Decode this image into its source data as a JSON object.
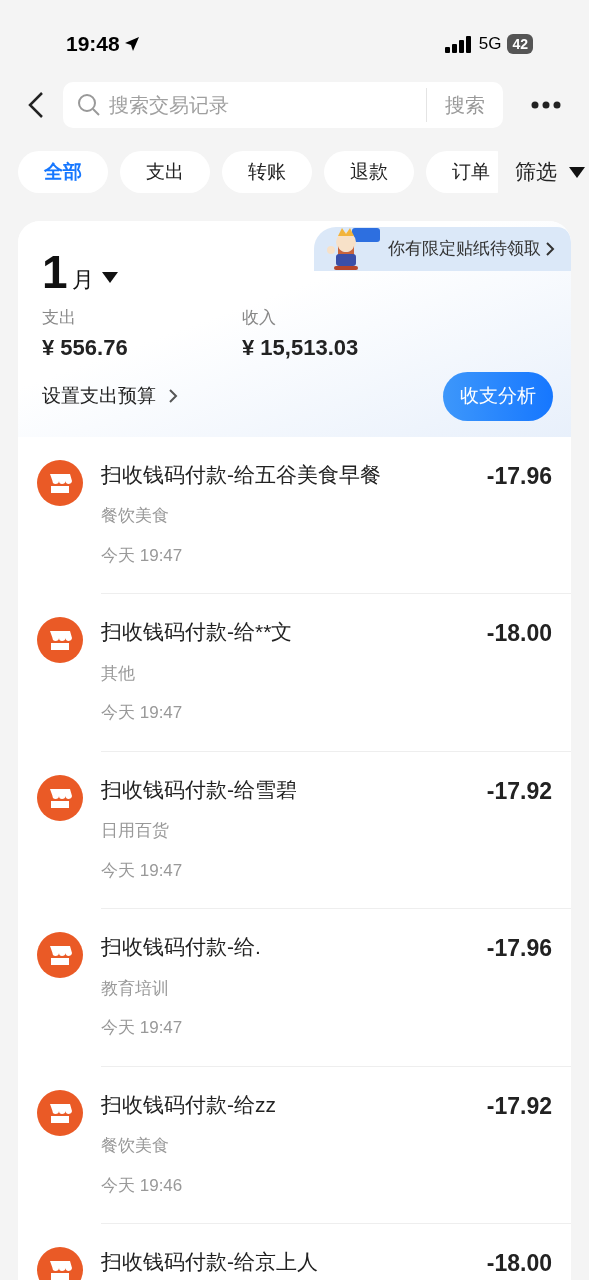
{
  "status_bar": {
    "time": "19:48",
    "network": "5G",
    "battery": "42"
  },
  "search": {
    "placeholder": "搜索交易记录",
    "button": "搜索"
  },
  "chips": [
    {
      "label": "全部",
      "selected": true
    },
    {
      "label": "支出",
      "selected": false
    },
    {
      "label": "转账",
      "selected": false
    },
    {
      "label": "退款",
      "selected": false
    },
    {
      "label": "订单",
      "selected": false
    }
  ],
  "filter": "筛选",
  "summary": {
    "banner": "你有限定贴纸待领取",
    "month": "1",
    "month_unit": "月",
    "expense_label": "支出",
    "expense": "¥ 556.76",
    "income_label": "收入",
    "income": "¥ 15,513.03",
    "budget_link": "设置支出预算",
    "analysis_button": "收支分析"
  },
  "transactions": [
    {
      "title": "扫收钱码付款-给五谷美食早餐",
      "category": "餐饮美食",
      "time": "今天 19:47",
      "amount": "-17.96"
    },
    {
      "title": "扫收钱码付款-给**文",
      "category": "其他",
      "time": "今天 19:47",
      "amount": "-18.00"
    },
    {
      "title": "扫收钱码付款-给雪碧",
      "category": "日用百货",
      "time": "今天 19:47",
      "amount": "-17.92"
    },
    {
      "title": "扫收钱码付款-给.",
      "category": "教育培训",
      "time": "今天 19:47",
      "amount": "-17.96"
    },
    {
      "title": "扫收钱码付款-给zz",
      "category": "餐饮美食",
      "time": "今天 19:46",
      "amount": "-17.92"
    },
    {
      "title": "扫收钱码付款-给京上人",
      "amount": "-18.00"
    }
  ]
}
